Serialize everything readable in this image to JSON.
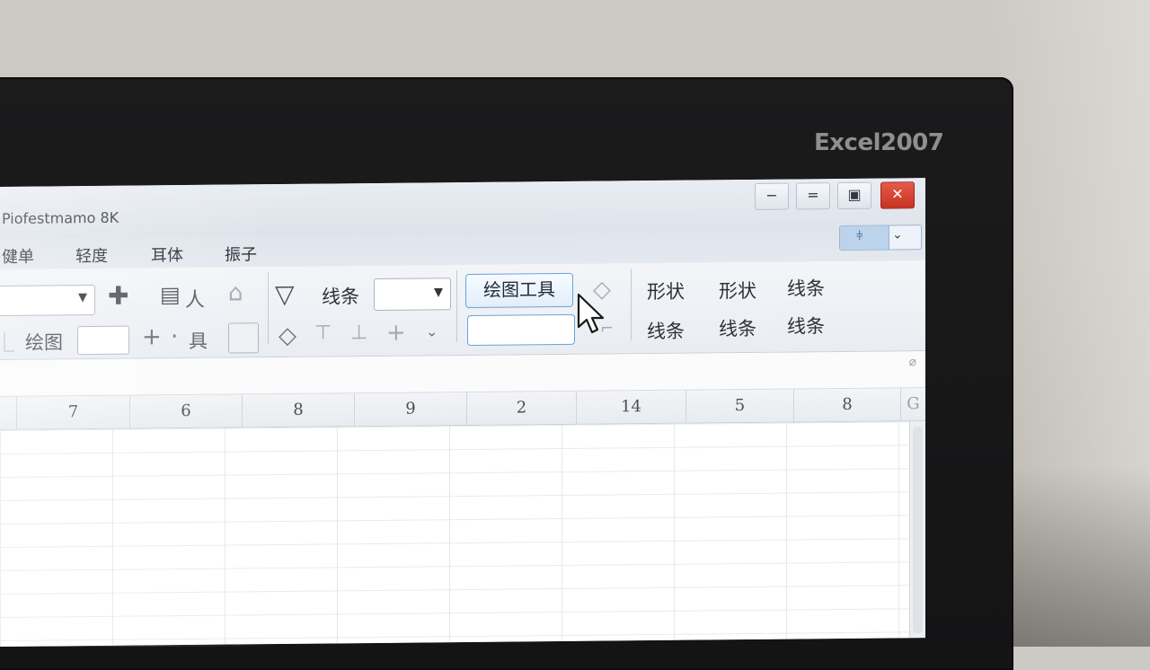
{
  "brand": "Excel2007",
  "window": {
    "title": "Piofestmamo 8K",
    "controls": {
      "minimize": "−",
      "restore": "=",
      "maximize": "▣",
      "close": "✕"
    }
  },
  "menu": [
    "健单",
    "轻度",
    "耳体",
    "振子"
  ],
  "ribbon_toggle": {
    "icon": "⫩",
    "arrow": "⌄"
  },
  "ribbon": {
    "row1": {
      "combo_value": "",
      "icon_label": "人",
      "lines_label": "线条",
      "draw_tools_label": "绘图工具"
    },
    "row2": {
      "draw_label": "绘图",
      "tool_label": "具"
    },
    "gallery": {
      "row1": [
        "形状",
        "形状",
        "线条"
      ],
      "row2": [
        "线条",
        "线条",
        "线条"
      ]
    }
  },
  "columns": [
    "7",
    "6",
    "8",
    "9",
    "2",
    "14",
    "5",
    "8",
    "G"
  ],
  "colors": {
    "accent": "#6aa3da",
    "close": "#d0402c",
    "bezel": "#161617"
  }
}
